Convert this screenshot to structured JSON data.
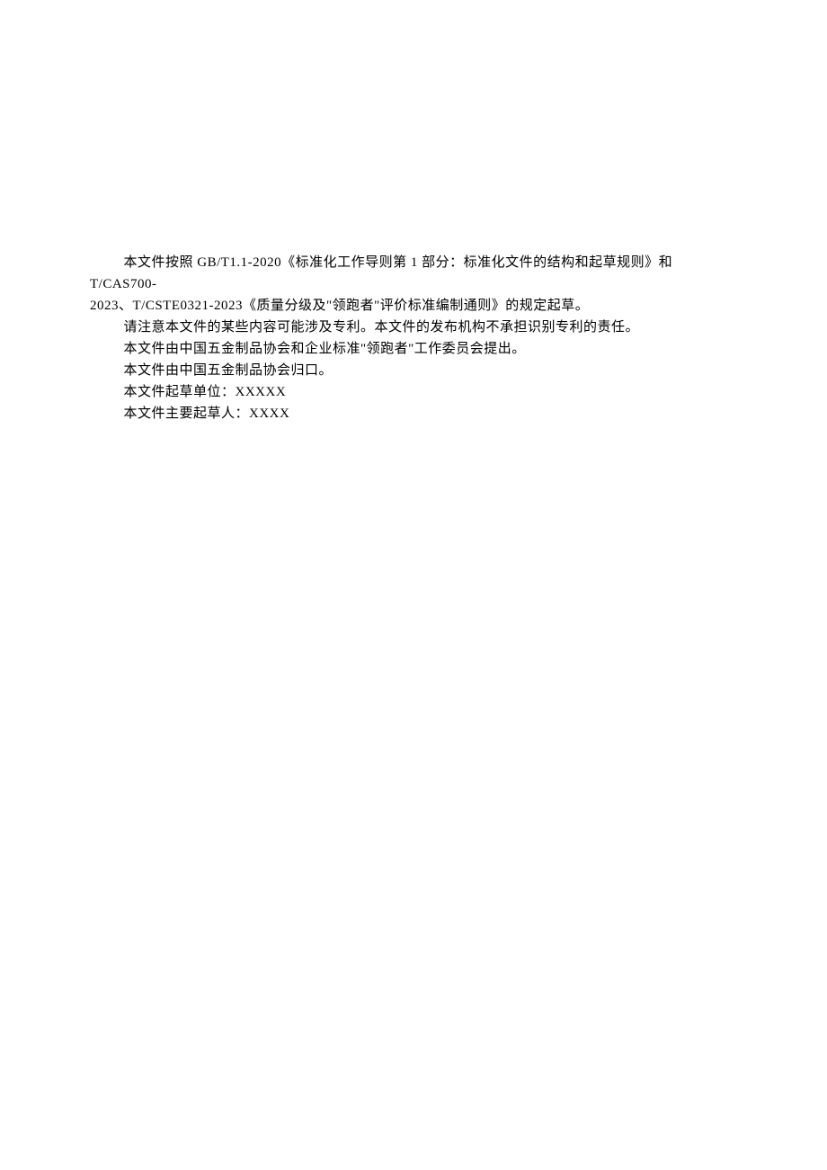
{
  "paragraphs": [
    {
      "line1": "本文件按照 GB/T1.1-2020《标准化工作导则第 1 部分：标准化文件的结构和起草规则》和 T/CAS700-",
      "line2": "2023、T/CSTE0321-2023《质量分级及\"领跑者\"评价标准编制通则》的规定起草。"
    },
    {
      "text": "请注意本文件的某些内容可能涉及专利。本文件的发布机构不承担识别专利的责任。"
    },
    {
      "text": "本文件由中国五金制品协会和企业标准\"领跑者\"工作委员会提出。"
    },
    {
      "text": "本文件由中国五金制品协会归口。"
    },
    {
      "text": "本文件起草单位：XXXXX"
    },
    {
      "text": "本文件主要起草人：XXXX"
    }
  ]
}
